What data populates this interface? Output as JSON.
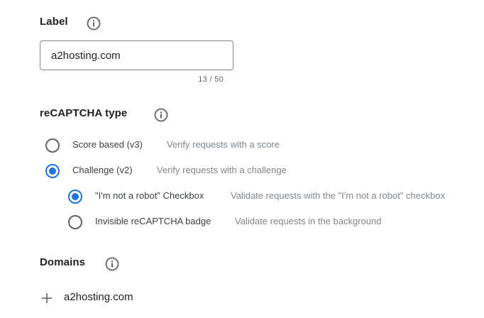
{
  "label_section": {
    "title": "Label",
    "info_icon": "info-icon",
    "input_value": "a2hosting.com",
    "counter": "13 / 50"
  },
  "recaptcha_section": {
    "title": "reCAPTCHA type",
    "info_icon": "info-icon",
    "options": [
      {
        "label": "Score based (v3)",
        "description": "Verify requests with a score",
        "selected": false
      },
      {
        "label": "Challenge (v2)",
        "description": "Verify requests with a challenge",
        "selected": true
      }
    ],
    "sub_options": [
      {
        "label": "\"I'm not a robot\" Checkbox",
        "description": "Validate requests with the \"I'm not a robot\" checkbox",
        "selected": true
      },
      {
        "label": "Invisible reCAPTCHA badge",
        "description": "Validate requests in the background",
        "selected": false
      }
    ]
  },
  "domains_section": {
    "title": "Domains",
    "info_icon": "info-icon",
    "add_icon": "plus-icon",
    "domain": "a2hosting.com"
  },
  "colors": {
    "accent": "#1a73e8",
    "text_primary": "#202124",
    "text_secondary": "#80868b",
    "border": "#80868b"
  }
}
